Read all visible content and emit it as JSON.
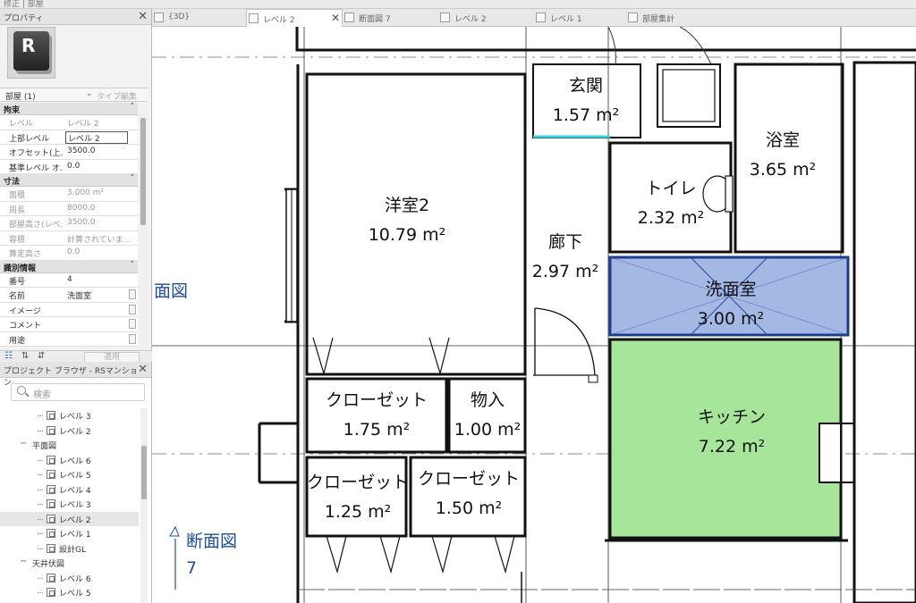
{
  "top_strip": {
    "text": "修正 | 部屋"
  },
  "properties": {
    "title": "プロパティ",
    "close": "✕",
    "type_selector": "部屋 (1)",
    "type_edit": "タイプ編集",
    "sections": [
      {
        "name": "拘束",
        "rows": [
          {
            "key": "レベル",
            "value": "レベル 2",
            "disabled": true
          },
          {
            "key": "上部レベル",
            "value": "レベル 2",
            "disabled": false,
            "editing": true
          },
          {
            "key": "オフセット(上...",
            "value": "3500.0",
            "disabled": false
          },
          {
            "key": "基準レベル オ...",
            "value": "0.0",
            "disabled": false
          }
        ]
      },
      {
        "name": "寸法",
        "rows": [
          {
            "key": "面積",
            "value": "3.000 m²",
            "disabled": true
          },
          {
            "key": "周長",
            "value": "8000.0",
            "disabled": true
          },
          {
            "key": "部屋高さ(レベ...",
            "value": "3500.0",
            "disabled": true
          },
          {
            "key": "容積",
            "value": "計算されていま...",
            "disabled": true
          },
          {
            "key": "算定高さ",
            "value": "0.0",
            "disabled": true
          }
        ]
      },
      {
        "name": "識別情報",
        "rows": [
          {
            "key": "番号",
            "value": "4",
            "disabled": false
          },
          {
            "key": "名前",
            "value": "洗面室",
            "disabled": false
          },
          {
            "key": "イメージ",
            "value": "",
            "disabled": false
          },
          {
            "key": "コメント",
            "value": "",
            "disabled": false
          },
          {
            "key": "用途",
            "value": "",
            "disabled": false
          }
        ]
      }
    ],
    "apply_button": "適用"
  },
  "browser": {
    "title": "プロジェクト ブラウザ - RSマンション...",
    "search_placeholder": "検索",
    "items": [
      {
        "label": "レベル 3",
        "kind": "view",
        "indent": 2
      },
      {
        "label": "レベル 2",
        "kind": "view",
        "indent": 2
      },
      {
        "label": "平面図",
        "kind": "group",
        "indent": 1
      },
      {
        "label": "レベル 6",
        "kind": "view",
        "indent": 2
      },
      {
        "label": "レベル 5",
        "kind": "view",
        "indent": 2
      },
      {
        "label": "レベル 4",
        "kind": "view",
        "indent": 2
      },
      {
        "label": "レベル 3",
        "kind": "view",
        "indent": 2
      },
      {
        "label": "レベル 2",
        "kind": "view",
        "indent": 2,
        "selected": true
      },
      {
        "label": "レベル 1",
        "kind": "view",
        "indent": 2
      },
      {
        "label": "設計GL",
        "kind": "view",
        "indent": 2
      },
      {
        "label": "天井伏図",
        "kind": "group",
        "indent": 1
      },
      {
        "label": "レベル 6",
        "kind": "view",
        "indent": 2
      },
      {
        "label": "レベル 5",
        "kind": "view",
        "indent": 2
      }
    ]
  },
  "tabs": [
    {
      "label": "{3D}",
      "active": false,
      "closable": false
    },
    {
      "label": "レベル 2",
      "active": true,
      "closable": true
    },
    {
      "label": "断面図 7",
      "active": false,
      "closable": false
    },
    {
      "label": "レベル 2",
      "active": false,
      "closable": false
    },
    {
      "label": "レベル 1",
      "active": false,
      "closable": false
    },
    {
      "label": "部屋集計",
      "active": false,
      "closable": false
    }
  ],
  "rooms": [
    {
      "name": "玄関",
      "area": "1.57 m²"
    },
    {
      "name": "浴室",
      "area": "3.65 m²"
    },
    {
      "name": "洋室2",
      "area": "10.79 m²"
    },
    {
      "name": "トイレ",
      "area": "2.32 m²"
    },
    {
      "name": "廊下",
      "area": "2.97 m²"
    },
    {
      "name": "洗面室",
      "area": "3.00 m²",
      "selected": true
    },
    {
      "name": "クローゼット",
      "area": "1.75 m²"
    },
    {
      "name": "物入",
      "area": "1.00 m²"
    },
    {
      "name": "キッチン",
      "area": "7.22 m²"
    },
    {
      "name": "クローゼット",
      "area": "1.25 m²"
    },
    {
      "name": "クローゼット",
      "area": "1.50 m²"
    }
  ],
  "section_tags": {
    "tag1": "面図",
    "tag2_line1": "断面図",
    "tag2_line2": "7"
  },
  "colors": {
    "selected_room": "#a4b8e4",
    "selected_border": "#1d3c8a",
    "kitchen": "#a6e59a",
    "section_tag": "#1f4fa3"
  }
}
